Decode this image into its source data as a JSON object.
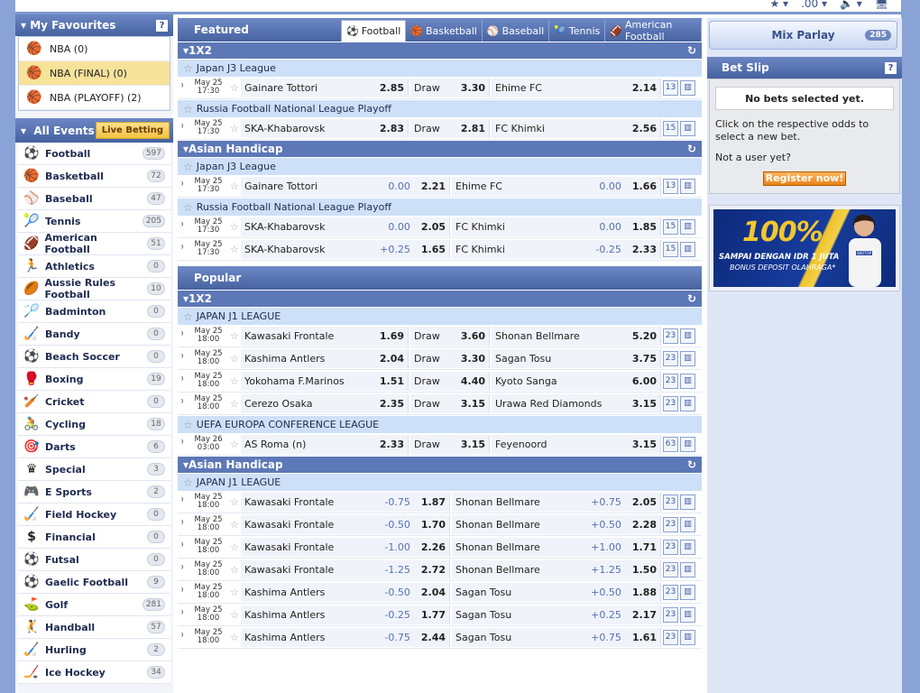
{
  "top": {
    "tools": [
      "★ ▾",
      ".00 ▾",
      "🔈 ▾",
      "🖥"
    ]
  },
  "favourites": {
    "title": "My Favourites",
    "help": "?",
    "items": [
      {
        "label": "NBA (0)",
        "selected": false
      },
      {
        "label": "NBA (FINAL) (0)",
        "selected": true
      },
      {
        "label": "NBA (PLAYOFF) (2)",
        "selected": false
      }
    ]
  },
  "events": {
    "title": "All Events",
    "live": "Live Betting",
    "sports": [
      {
        "name": "Football",
        "count": "597",
        "icon": "football-icon",
        "glyph": "⚽"
      },
      {
        "name": "Basketball",
        "count": "72",
        "icon": "basketball-icon",
        "glyph": "🏀"
      },
      {
        "name": "Baseball",
        "count": "47",
        "icon": "baseball-icon",
        "glyph": "⚾"
      },
      {
        "name": "Tennis",
        "count": "205",
        "icon": "tennis-icon",
        "glyph": "🎾"
      },
      {
        "name": "American Football",
        "count": "51",
        "icon": "american-football-icon",
        "glyph": "🏈"
      },
      {
        "name": "Athletics",
        "count": "0",
        "icon": "athletics-icon",
        "glyph": "🏃"
      },
      {
        "name": "Aussie Rules Football",
        "count": "10",
        "icon": "aussie-rules-icon",
        "glyph": "🏉"
      },
      {
        "name": "Badminton",
        "count": "0",
        "icon": "badminton-icon",
        "glyph": "🏸"
      },
      {
        "name": "Bandy",
        "count": "0",
        "icon": "bandy-icon",
        "glyph": "🏑"
      },
      {
        "name": "Beach Soccer",
        "count": "0",
        "icon": "beach-soccer-icon",
        "glyph": "⚽"
      },
      {
        "name": "Boxing",
        "count": "19",
        "icon": "boxing-icon",
        "glyph": "🥊"
      },
      {
        "name": "Cricket",
        "count": "0",
        "icon": "cricket-icon",
        "glyph": "🏏"
      },
      {
        "name": "Cycling",
        "count": "18",
        "icon": "cycling-icon",
        "glyph": "🚴"
      },
      {
        "name": "Darts",
        "count": "6",
        "icon": "darts-icon",
        "glyph": "🎯"
      },
      {
        "name": "Special",
        "count": "3",
        "icon": "special-icon",
        "glyph": "♛"
      },
      {
        "name": "E Sports",
        "count": "2",
        "icon": "esports-icon",
        "glyph": "🎮"
      },
      {
        "name": "Field Hockey",
        "count": "0",
        "icon": "field-hockey-icon",
        "glyph": "🏑"
      },
      {
        "name": "Financial",
        "count": "0",
        "icon": "financial-icon",
        "glyph": "$"
      },
      {
        "name": "Futsal",
        "count": "0",
        "icon": "futsal-icon",
        "glyph": "⚽"
      },
      {
        "name": "Gaelic Football",
        "count": "9",
        "icon": "gaelic-football-icon",
        "glyph": "⚽"
      },
      {
        "name": "Golf",
        "count": "281",
        "icon": "golf-icon",
        "glyph": "⛳"
      },
      {
        "name": "Handball",
        "count": "57",
        "icon": "handball-icon",
        "glyph": "🤾"
      },
      {
        "name": "Hurling",
        "count": "2",
        "icon": "hurling-icon",
        "glyph": "🏑"
      },
      {
        "name": "Ice Hockey",
        "count": "34",
        "icon": "ice-hockey-icon",
        "glyph": "🏒"
      }
    ]
  },
  "featured": {
    "title": "Featured",
    "tabs": [
      {
        "label": "Football",
        "glyph": "⚽",
        "icon": "football-icon",
        "active": true
      },
      {
        "label": "Basketball",
        "glyph": "🏀",
        "icon": "basketball-icon",
        "active": false
      },
      {
        "label": "Baseball",
        "glyph": "⚾",
        "icon": "baseball-icon",
        "active": false
      },
      {
        "label": "Tennis",
        "glyph": "🎾",
        "icon": "tennis-icon",
        "active": false
      },
      {
        "label": "American Football",
        "glyph": "🏈",
        "icon": "american-football-icon",
        "active": false
      }
    ]
  },
  "sections": [
    {
      "type": "header",
      "text": "Featured"
    },
    {
      "type": "bet",
      "text": "1X2"
    },
    {
      "type": "league",
      "text": "Japan J3 League"
    },
    {
      "type": "x12",
      "date": "May 25",
      "time": "17:30",
      "home": "Gainare Tottori",
      "h": "2.85",
      "draw": "Draw",
      "d": "3.30",
      "away": "Ehime FC",
      "a": "2.14",
      "more": "13"
    },
    {
      "type": "league",
      "text": "Russia Football National League Playoff"
    },
    {
      "type": "x12",
      "date": "May 25",
      "time": "17:30",
      "home": "SKA-Khabarovsk",
      "h": "2.83",
      "draw": "Draw",
      "d": "2.81",
      "away": "FC Khimki",
      "a": "2.56",
      "more": "15"
    },
    {
      "type": "bet",
      "text": "Asian Handicap"
    },
    {
      "type": "league",
      "text": "Japan J3 League"
    },
    {
      "type": "ah",
      "date": "May 25",
      "time": "17:30",
      "home": "Gainare Tottori",
      "hh": "0.00",
      "h": "2.21",
      "away": "Ehime FC",
      "ah": "0.00",
      "a": "1.66",
      "more": "13"
    },
    {
      "type": "league",
      "text": "Russia Football National League Playoff"
    },
    {
      "type": "ah",
      "date": "May 25",
      "time": "17:30",
      "home": "SKA-Khabarovsk",
      "hh": "0.00",
      "h": "2.05",
      "away": "FC Khimki",
      "ah": "0.00",
      "a": "1.85",
      "more": "15"
    },
    {
      "type": "ah",
      "date": "May 25",
      "time": "17:30",
      "home": "SKA-Khabarovsk",
      "hh": "+0.25",
      "h": "1.65",
      "away": "FC Khimki",
      "ah": "-0.25",
      "a": "2.33",
      "more": "15"
    },
    {
      "type": "popular",
      "text": "Popular"
    },
    {
      "type": "bet",
      "text": "1X2"
    },
    {
      "type": "league",
      "text": "JAPAN J1 LEAGUE"
    },
    {
      "type": "x12",
      "date": "May 25",
      "time": "18:00",
      "home": "Kawasaki Frontale",
      "h": "1.69",
      "draw": "Draw",
      "d": "3.60",
      "away": "Shonan Bellmare",
      "a": "5.20",
      "more": "23"
    },
    {
      "type": "x12",
      "date": "May 25",
      "time": "18:00",
      "home": "Kashima Antlers",
      "h": "2.04",
      "draw": "Draw",
      "d": "3.30",
      "away": "Sagan Tosu",
      "a": "3.75",
      "more": "23"
    },
    {
      "type": "x12",
      "date": "May 25",
      "time": "18:00",
      "home": "Yokohama F.Marinos",
      "h": "1.51",
      "draw": "Draw",
      "d": "4.40",
      "away": "Kyoto Sanga",
      "a": "6.00",
      "more": "23"
    },
    {
      "type": "x12",
      "date": "May 25",
      "time": "18:00",
      "home": "Cerezo Osaka",
      "h": "2.35",
      "draw": "Draw",
      "d": "3.15",
      "away": "Urawa Red Diamonds",
      "a": "3.15",
      "more": "23"
    },
    {
      "type": "league",
      "text": "UEFA EUROPA CONFERENCE LEAGUE"
    },
    {
      "type": "x12",
      "date": "May 26",
      "time": "03:00",
      "home": "AS Roma (n)",
      "h": "2.33",
      "draw": "Draw",
      "d": "3.15",
      "away": "Feyenoord",
      "a": "3.15",
      "more": "63"
    },
    {
      "type": "bet",
      "text": "Asian Handicap"
    },
    {
      "type": "league",
      "text": "JAPAN J1 LEAGUE"
    },
    {
      "type": "ah",
      "date": "May 25",
      "time": "18:00",
      "home": "Kawasaki Frontale",
      "hh": "-0.75",
      "h": "1.87",
      "away": "Shonan Bellmare",
      "ah": "+0.75",
      "a": "2.05",
      "more": "23"
    },
    {
      "type": "ah",
      "date": "May 25",
      "time": "18:00",
      "home": "Kawasaki Frontale",
      "hh": "-0.50",
      "h": "1.70",
      "away": "Shonan Bellmare",
      "ah": "+0.50",
      "a": "2.28",
      "more": "23"
    },
    {
      "type": "ah",
      "date": "May 25",
      "time": "18:00",
      "home": "Kawasaki Frontale",
      "hh": "-1.00",
      "h": "2.26",
      "away": "Shonan Bellmare",
      "ah": "+1.00",
      "a": "1.71",
      "more": "23"
    },
    {
      "type": "ah",
      "date": "May 25",
      "time": "18:00",
      "home": "Kawasaki Frontale",
      "hh": "-1.25",
      "h": "2.72",
      "away": "Shonan Bellmare",
      "ah": "+1.25",
      "a": "1.50",
      "more": "23"
    },
    {
      "type": "ah",
      "date": "May 25",
      "time": "18:00",
      "home": "Kashima Antlers",
      "hh": "-0.50",
      "h": "2.04",
      "away": "Sagan Tosu",
      "ah": "+0.50",
      "a": "1.88",
      "more": "23"
    },
    {
      "type": "ah",
      "date": "May 25",
      "time": "18:00",
      "home": "Kashima Antlers",
      "hh": "-0.25",
      "h": "1.77",
      "away": "Sagan Tosu",
      "ah": "+0.25",
      "a": "2.17",
      "more": "23"
    },
    {
      "type": "ah",
      "date": "May 25",
      "time": "18:00",
      "home": "Kashima Antlers",
      "hh": "-0.75",
      "h": "2.44",
      "away": "Sagan Tosu",
      "ah": "+0.75",
      "a": "1.61",
      "more": "23"
    }
  ],
  "right": {
    "mix": "Mix Parlay",
    "mix_count": "285",
    "betslip_title": "Bet Slip",
    "help": "?",
    "no_bets": "No bets selected yet.",
    "instr": "Click on the respective odds to select a new bet.",
    "notuser": "Not a user yet?",
    "register": "Register now!",
    "banner_big": "100%",
    "banner_line1": "SAMPAI DENGAN IDR 1 JUTA",
    "banner_line2": "BONUS DEPOSIT OLAHRAGA*",
    "banner_brand": "SBOTOP"
  }
}
